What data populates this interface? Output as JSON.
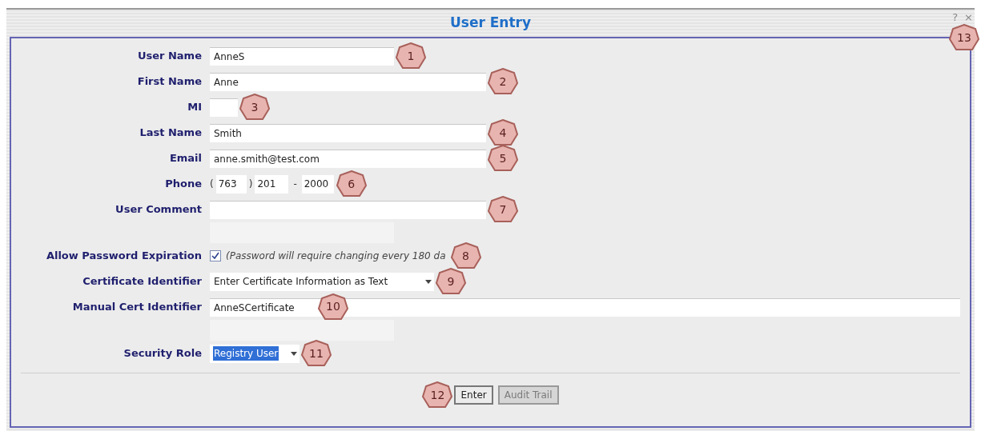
{
  "window": {
    "title": "User Entry",
    "help": "?",
    "close": "×",
    "callout": "13"
  },
  "fields": [
    {
      "kind": "text",
      "label": "User Name",
      "value": "AnneS",
      "callout": "1"
    },
    {
      "kind": "text",
      "label": "First Name",
      "value": "Anne",
      "callout": "2"
    },
    {
      "kind": "text",
      "label": "MI",
      "callout": "3"
    },
    {
      "kind": "text",
      "label": "Last Name",
      "value": "Smith",
      "callout": "4"
    },
    {
      "kind": "text",
      "label": "Email",
      "value": "anne.smith@test.com",
      "callout": "5"
    },
    {
      "kind": "phone",
      "label": "Phone",
      "open": "(",
      "area": "763",
      "close": ")",
      "prefix": "201",
      "dash": "-",
      "line": "2000",
      "callout": "6"
    },
    {
      "kind": "text",
      "label": "User Comment",
      "callout": "7"
    },
    {
      "kind": "spacer"
    },
    {
      "kind": "checkbox",
      "label": "Allow Password Expiration",
      "checked": true,
      "note": "(Password will require changing every 180 da",
      "callout": "8"
    },
    {
      "kind": "select",
      "label": "Certificate Identifier",
      "value": "Enter Certificate Information as Text",
      "highlighted": false,
      "callout": "9"
    },
    {
      "kind": "wide",
      "label": "Manual Cert Identifier",
      "value": "AnneSCertificate",
      "callout": "10"
    },
    {
      "kind": "spacer"
    },
    {
      "kind": "select",
      "label": "Security Role",
      "value": "Registry User",
      "highlighted": true,
      "callout": "11"
    }
  ],
  "buttons": [
    {
      "label": "Enter",
      "disabled": false,
      "callout": "12"
    },
    {
      "label": "Audit Trail",
      "disabled": true
    }
  ]
}
